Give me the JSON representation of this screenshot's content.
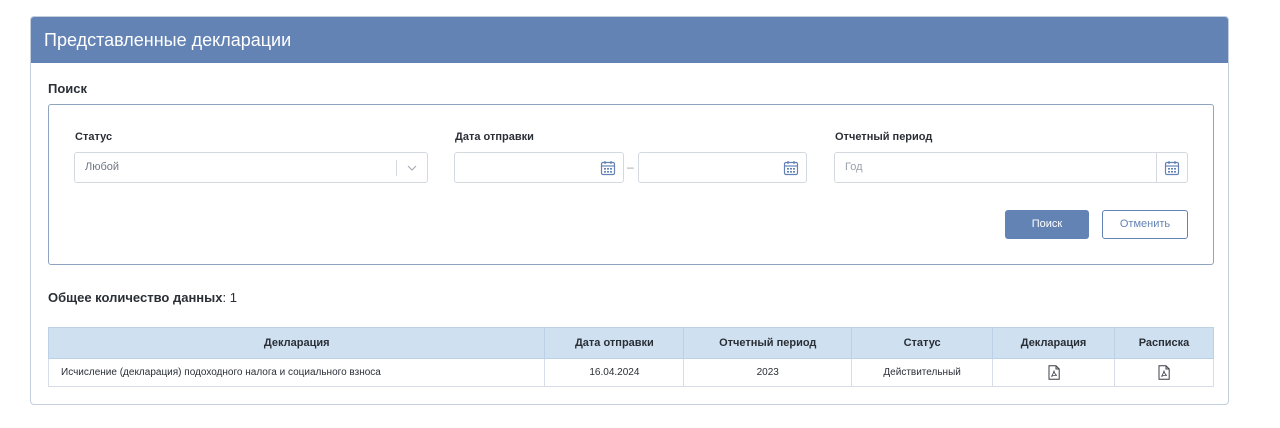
{
  "header": {
    "title": "Представленные декларации"
  },
  "search": {
    "section_title": "Поиск",
    "status": {
      "label": "Статус",
      "value": "Любой"
    },
    "date_sent": {
      "label": "Дата отправки",
      "from": "",
      "to": "",
      "separator": "–"
    },
    "period": {
      "label": "Отчетный период",
      "placeholder": "Год"
    },
    "search_button": "Поиск",
    "cancel_button": "Отменить"
  },
  "results": {
    "count_label": "Общее количество данных",
    "count_value": ": 1",
    "columns": [
      "Декларация",
      "Дата отправки",
      "Отчетный период",
      "Статус",
      "Декларация",
      "Расписка"
    ],
    "rows": [
      {
        "declaration": "Исчисление (декларация) подоходного налога и социального взноса",
        "date_sent": "16.04.2024",
        "period": "2023",
        "status": "Действительный",
        "declaration_file_icon": "pdf-file-icon",
        "receipt_file_icon": "pdf-file-icon"
      }
    ]
  },
  "colors": {
    "header_bg": "#6383b5",
    "table_header_bg": "#cfe0f1",
    "primary": "#6383b5"
  }
}
